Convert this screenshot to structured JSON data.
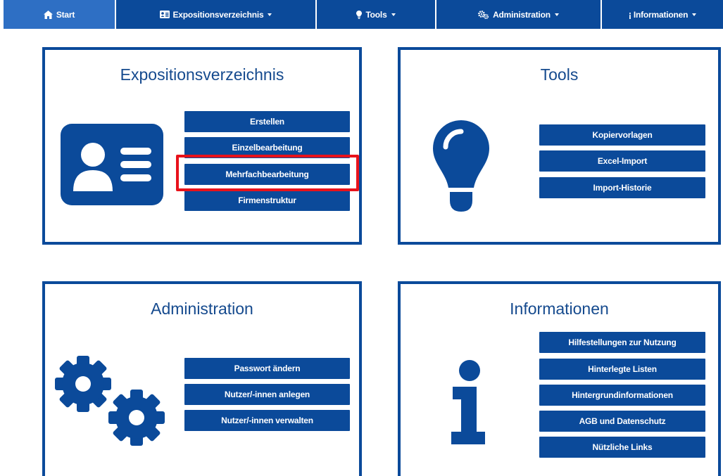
{
  "nav": {
    "start": "Start",
    "expositionsverzeichnis": "Expositionsverzeichnis",
    "tools": "Tools",
    "administration": "Administration",
    "informationen": "Informationen"
  },
  "cards": {
    "expositionsverzeichnis": {
      "title": "Expositionsverzeichnis",
      "buttons": [
        "Erstellen",
        "Einzelbearbeitung",
        "Mehrfachbearbeitung",
        "Firmenstruktur"
      ]
    },
    "tools": {
      "title": "Tools",
      "buttons": [
        "Kopiervorlagen",
        "Excel-Import",
        "Import-Historie"
      ]
    },
    "administration": {
      "title": "Administration",
      "buttons": [
        "Passwort ändern",
        "Nutzer/-innen anlegen",
        "Nutzer/-innen verwalten"
      ]
    },
    "informationen": {
      "title": "Informationen",
      "buttons": [
        "Hilfestellungen zur Nutzung",
        "Hinterlegte Listen",
        "Hintergrundinformationen",
        "AGB und Datenschutz",
        "Nützliche Links"
      ]
    }
  },
  "colors": {
    "brand": "#0b4a9a",
    "active_nav": "#2e6fc4",
    "highlight": "#e8121b"
  }
}
